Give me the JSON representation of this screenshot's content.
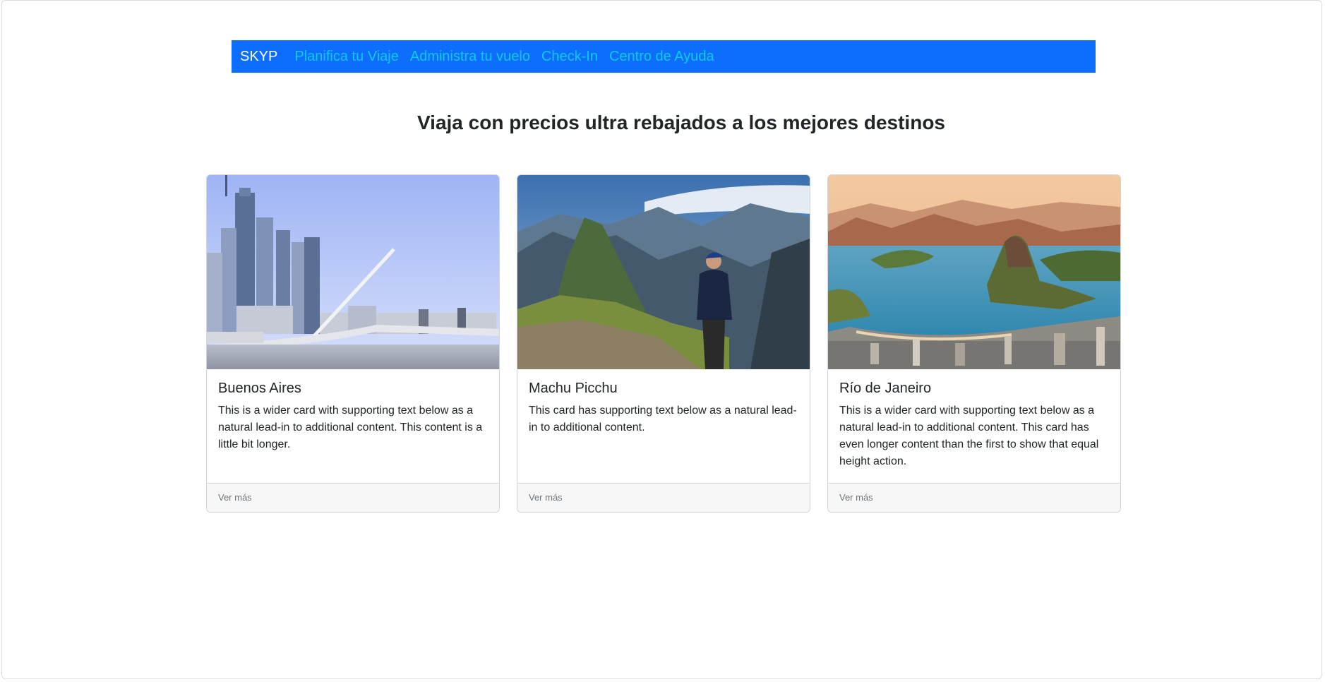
{
  "navbar": {
    "brand": "SKYP",
    "links": [
      {
        "label": "Planifica tu Viaje"
      },
      {
        "label": "Administra tu vuelo"
      },
      {
        "label": "Check-In"
      },
      {
        "label": "Centro de Ayuda"
      }
    ],
    "bg_color": "#0d6efd",
    "link_color": "#0dcaf0"
  },
  "main": {
    "headline": "Viaja con precios ultra rebajados a los mejores destinos",
    "cards": [
      {
        "title": "Buenos Aires",
        "text": "This is a wider card with supporting text below as a natural lead-in to additional content. This content is a little bit longer.",
        "footer": "Ver más"
      },
      {
        "title": "Machu Picchu",
        "text": "This card has supporting text below as a natural lead-in to additional content.",
        "footer": "Ver más"
      },
      {
        "title": "Río de Janeiro",
        "text": "This is a wider card with supporting text below as a natural lead-in to additional content. This card has even longer content than the first to show that equal height action.",
        "footer": "Ver más"
      }
    ]
  }
}
